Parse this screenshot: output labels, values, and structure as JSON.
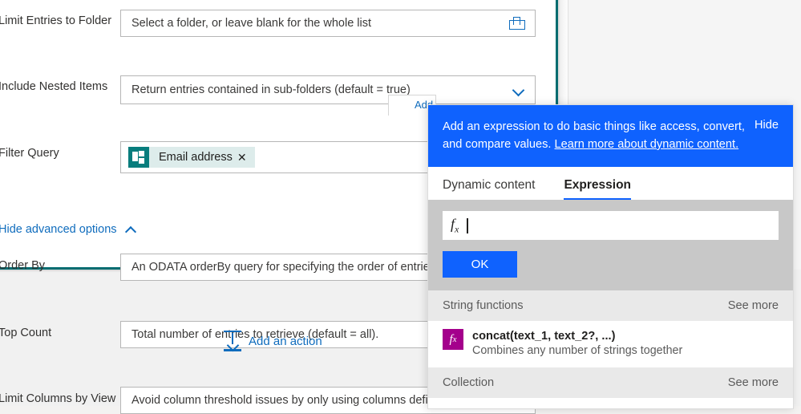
{
  "form": {
    "rows": [
      {
        "label": "Limit Entries to Folder",
        "placeholder": "Select a folder, or leave blank for the whole list",
        "trailing_icon": "folder-icon"
      },
      {
        "label": "Include Nested Items",
        "placeholder": "Return entries contained in sub-folders (default = true)",
        "trailing_icon": "chevron-down-icon"
      },
      {
        "label": "Filter Query",
        "placeholder": "",
        "token": {
          "text": "Email address",
          "remove": "✕",
          "icon": "sharepoint-icon"
        }
      },
      {
        "label": "Order By",
        "placeholder": "An ODATA orderBy query for specifying the order of entries.",
        "trailing_icon": ""
      },
      {
        "label": "Top Count",
        "placeholder": "Total number of entries to retrieve (default = all).",
        "trailing_icon": ""
      },
      {
        "label": "Limit Columns by View",
        "placeholder": "Avoid column threshold issues by only using columns defined in a view.",
        "trailing_icon": ""
      }
    ],
    "advanced_link": "Hide advanced options",
    "add_action_label": "Add an action",
    "dynamic_content_peek": "Add"
  },
  "panel": {
    "banner": {
      "text_before_link": "Add an expression to do basic things like access, convert, and compare values. ",
      "link_text": "Learn more about dynamic content.",
      "hide_label": "Hide"
    },
    "tabs": [
      {
        "label": "Dynamic content",
        "active": false
      },
      {
        "label": "Expression",
        "active": true
      }
    ],
    "expression_input": {
      "value": "",
      "fx_label": "fx"
    },
    "ok_label": "OK",
    "sections": [
      {
        "name": "String functions",
        "see_more": "See more",
        "functions": [
          {
            "icon_label": "fx",
            "signature": "concat(text_1, text_2?, ...)",
            "description": "Combines any number of strings together"
          }
        ]
      },
      {
        "name": "Collection",
        "see_more": "See more",
        "functions": []
      }
    ]
  },
  "colors": {
    "accent_blue": "#0f62fe",
    "link_blue": "#0f6cbd",
    "sharepoint_teal": "#036c70",
    "function_magenta": "#a4008c"
  }
}
